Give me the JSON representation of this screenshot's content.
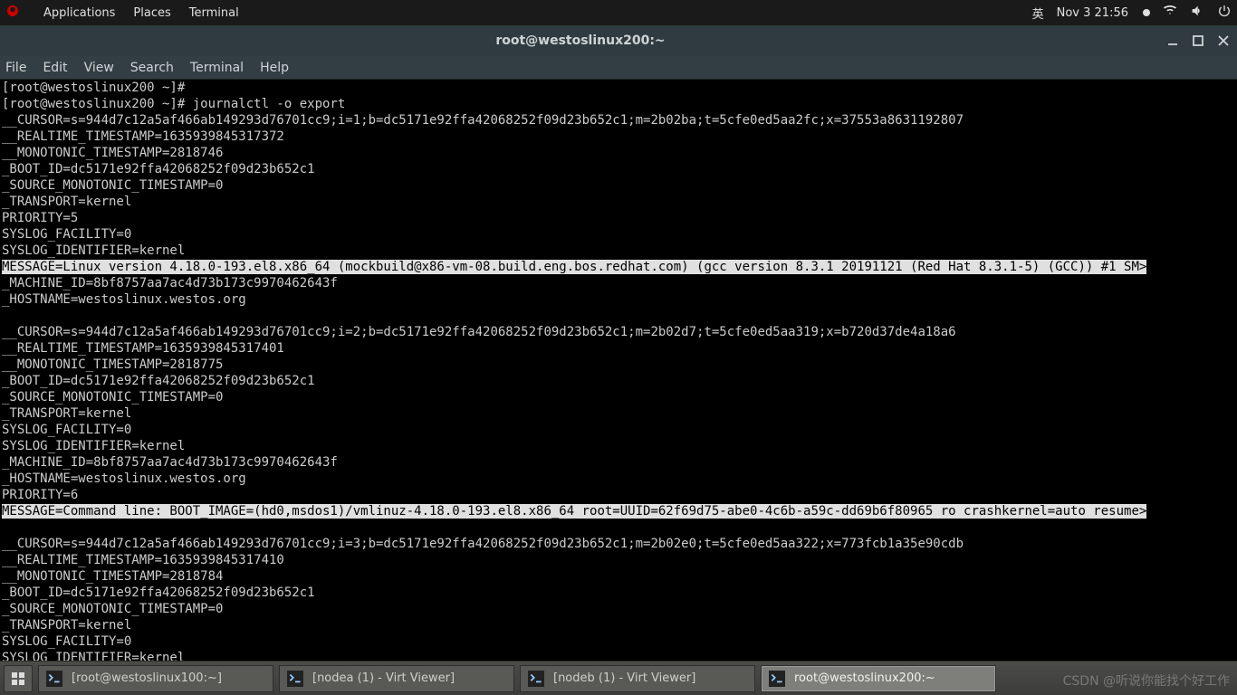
{
  "top_panel": {
    "menus": [
      "Applications",
      "Places",
      "Terminal"
    ],
    "ime": "英",
    "clock": "Nov 3  21:56"
  },
  "window": {
    "title": "root@westoslinux200:~",
    "menus": [
      "File",
      "Edit",
      "View",
      "Search",
      "Terminal",
      "Help"
    ]
  },
  "terminal_lines": [
    "[root@westoslinux200 ~]#",
    "[root@westoslinux200 ~]# journalctl -o export",
    "__CURSOR=s=944d7c12a5af466ab149293d76701cc9;i=1;b=dc5171e92ffa42068252f09d23b652c1;m=2b02ba;t=5cfe0ed5aa2fc;x=37553a8631192807",
    "__REALTIME_TIMESTAMP=1635939845317372",
    "__MONOTONIC_TIMESTAMP=2818746",
    "_BOOT_ID=dc5171e92ffa42068252f09d23b652c1",
    "_SOURCE_MONOTONIC_TIMESTAMP=0",
    "_TRANSPORT=kernel",
    "PRIORITY=5",
    "SYSLOG_FACILITY=0",
    "SYSLOG_IDENTIFIER=kernel",
    "MESSAGE=Linux version 4.18.0-193.el8.x86_64 (mockbuild@x86-vm-08.build.eng.bos.redhat.com) (gcc version 8.3.1 20191121 (Red Hat 8.3.1-5) (GCC)) #1 SM>",
    "_MACHINE_ID=8bf8757aa7ac4d73b173c9970462643f",
    "_HOSTNAME=westoslinux.westos.org",
    "",
    "__CURSOR=s=944d7c12a5af466ab149293d76701cc9;i=2;b=dc5171e92ffa42068252f09d23b652c1;m=2b02d7;t=5cfe0ed5aa319;x=b720d37de4a18a6",
    "__REALTIME_TIMESTAMP=1635939845317401",
    "__MONOTONIC_TIMESTAMP=2818775",
    "_BOOT_ID=dc5171e92ffa42068252f09d23b652c1",
    "_SOURCE_MONOTONIC_TIMESTAMP=0",
    "_TRANSPORT=kernel",
    "SYSLOG_FACILITY=0",
    "SYSLOG_IDENTIFIER=kernel",
    "_MACHINE_ID=8bf8757aa7ac4d73b173c9970462643f",
    "_HOSTNAME=westoslinux.westos.org",
    "PRIORITY=6",
    "MESSAGE=Command line: BOOT_IMAGE=(hd0,msdos1)/vmlinuz-4.18.0-193.el8.x86_64 root=UUID=62f69d75-abe0-4c6b-a59c-dd69b6f80965 ro crashkernel=auto resume>",
    "",
    "__CURSOR=s=944d7c12a5af466ab149293d76701cc9;i=3;b=dc5171e92ffa42068252f09d23b652c1;m=2b02e0;t=5cfe0ed5aa322;x=773fcb1a35e90cdb",
    "__REALTIME_TIMESTAMP=1635939845317410",
    "__MONOTONIC_TIMESTAMP=2818784",
    "_BOOT_ID=dc5171e92ffa42068252f09d23b652c1",
    "_SOURCE_MONOTONIC_TIMESTAMP=0",
    "_TRANSPORT=kernel",
    "SYSLOG_FACILITY=0",
    "SYSLOG_IDENTIFIER=kernel"
  ],
  "highlight_line_indexes": [
    11,
    26
  ],
  "taskbar": {
    "items": [
      {
        "label": "[root@westoslinux100:~]",
        "active": false
      },
      {
        "label": "[nodea (1) - Virt Viewer]",
        "active": false
      },
      {
        "label": "[nodeb (1) - Virt Viewer]",
        "active": false
      },
      {
        "label": "root@westoslinux200:~",
        "active": true
      }
    ]
  },
  "watermark": "CSDN @听说你能找个好工作"
}
